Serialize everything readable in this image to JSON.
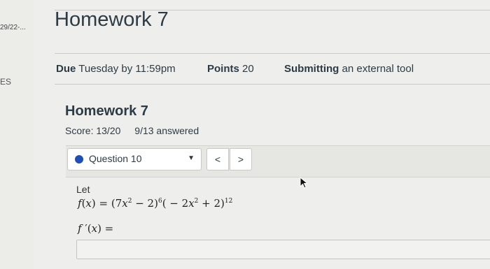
{
  "sidebar": {
    "date_fragment": "29/22-...",
    "text_fragment": "ES"
  },
  "page": {
    "title": "Homework 7"
  },
  "details": {
    "due_label": "Due",
    "due_value": "Tuesday by 11:59pm",
    "points_label": "Points",
    "points_value": "20",
    "submitting_label": "Submitting",
    "submitting_value": "an external tool"
  },
  "tool": {
    "title": "Homework 7",
    "score": "Score: 13/20",
    "answered": "9/13 answered"
  },
  "question_nav": {
    "selected": "Question 10",
    "prev_label": "<",
    "next_label": ">"
  },
  "problem": {
    "intro": "Let",
    "answer_value": ""
  },
  "colors": {
    "background": "#eeeeec",
    "dot": "#1f4fb4",
    "text": "#2d3b45"
  }
}
